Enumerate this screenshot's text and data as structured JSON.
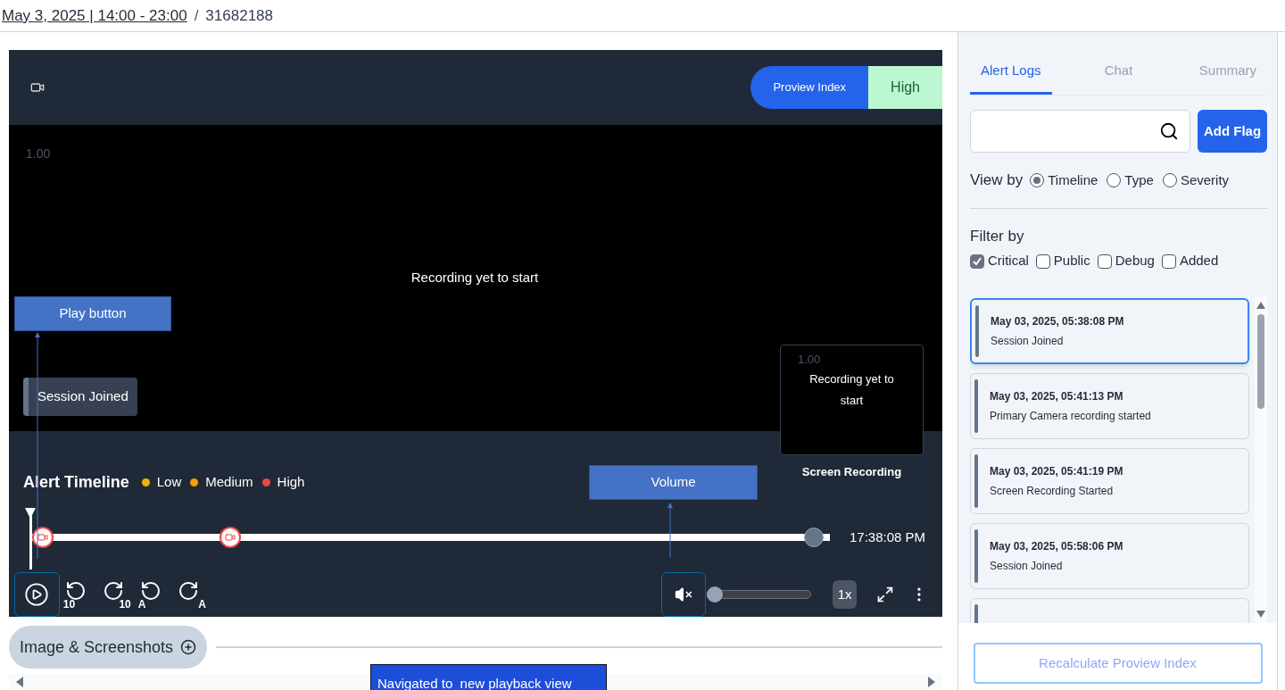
{
  "header": {
    "date_link": "May 3, 2025 | 14:00 - 23:00",
    "separator": "/",
    "session_id": "31682188"
  },
  "player": {
    "badges": [
      {
        "kind": "index",
        "label": "Proview Index"
      },
      {
        "kind": "level",
        "label": "High"
      }
    ],
    "video": {
      "scale": "1.00",
      "message": "Recording yet to start"
    },
    "session_chip": "Session Joined",
    "pip": {
      "scale": "1.00",
      "message": "Recording yet to start",
      "label": "Screen Recording"
    },
    "timeline": {
      "title": "Alert Timeline",
      "legend": [
        {
          "label": "Low",
          "color": "#eab308"
        },
        {
          "label": "Medium",
          "color": "#f59e0b"
        },
        {
          "label": "High",
          "color": "#ef4444"
        }
      ],
      "level": 0.98,
      "time": "17:38:08 PM"
    },
    "skip_buttons": [
      {
        "kind": "back",
        "label": "10"
      },
      {
        "kind": "forward",
        "label": "10"
      },
      {
        "kind": "back",
        "label": "A"
      },
      {
        "kind": "forward",
        "label": "A"
      }
    ],
    "muted": true,
    "volume": {
      "level": 0
    },
    "speed": "1x"
  },
  "annotations": [
    {
      "kind": "play",
      "label": "Play button"
    },
    {
      "kind": "volume",
      "label": "Volume"
    },
    {
      "kind": "nav",
      "label": "Navigated to  new playback view"
    }
  ],
  "section": {
    "title": "Image & Screenshots"
  },
  "side": {
    "tabs": [
      {
        "label": "Alert Logs",
        "selected": true
      },
      {
        "label": "Chat",
        "selected": false
      },
      {
        "label": "Summary",
        "selected": false
      }
    ],
    "add_flag": "Add Flag",
    "view_by": {
      "label": "View by",
      "options": [
        {
          "label": "Timeline",
          "selected": true
        },
        {
          "label": "Type",
          "selected": false
        },
        {
          "label": "Severity",
          "selected": false
        }
      ]
    },
    "filter_by": {
      "label": "Filter by",
      "options": [
        {
          "label": "Critical",
          "checked": true
        },
        {
          "label": "Public",
          "checked": false
        },
        {
          "label": "Debug",
          "checked": false
        },
        {
          "label": "Added",
          "checked": false
        }
      ]
    },
    "alerts": [
      {
        "time": "May 03, 2025, 05:38:08 PM",
        "text": "Session Joined",
        "selected": true
      },
      {
        "time": "May 03, 2025, 05:41:13 PM",
        "text": "Primary Camera recording started",
        "selected": false
      },
      {
        "time": "May 03, 2025, 05:41:19 PM",
        "text": "Screen Recording Started",
        "selected": false
      },
      {
        "time": "May 03, 2025, 05:58:06 PM",
        "text": "Session Joined",
        "selected": false
      }
    ],
    "recalculate": "Recalculate Proview Index"
  }
}
